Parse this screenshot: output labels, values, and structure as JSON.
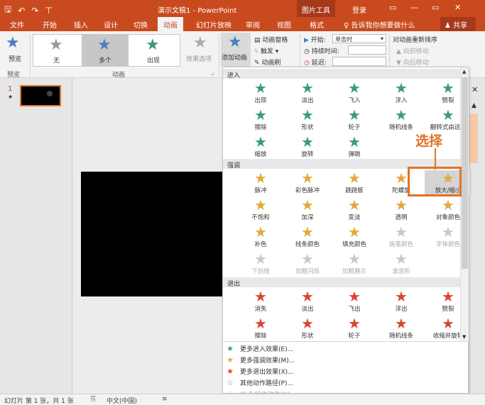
{
  "titlebar": {
    "title": "演示文稿1 - PowerPoint",
    "context": "图片工具",
    "login": "登录",
    "save_glyph": "🖫",
    "undo_glyph": "↶",
    "redo_glyph": "↷",
    "customize_glyph": "⊤",
    "min": "▭",
    "max": "▭",
    "close": "✕"
  },
  "tabs": [
    "文件",
    "开始",
    "插入",
    "设计",
    "切换",
    "动画",
    "幻灯片放映",
    "审阅",
    "视图",
    "格式"
  ],
  "tell": "告诉我你想要做什么",
  "share": "共享",
  "ribbon": {
    "preview": "预览",
    "group_preview": "预览",
    "gallery": [
      {
        "label": "无",
        "icon": "★"
      },
      {
        "label": "多个",
        "icon": "★"
      },
      {
        "label": "出现",
        "icon": "★"
      }
    ],
    "effect_options": "效果选项",
    "group_animation": "动画",
    "add_animation": "添加动画",
    "anim_pane": "动画窗格",
    "trigger": "触发",
    "anim_painter": "动画刷",
    "start_label": "开始:",
    "start_value": "单击时",
    "duration_label": "持续时间:",
    "delay_label": "延迟:",
    "reorder": "对动画重新排序",
    "move_earlier": "向前移动",
    "move_later": "向后移动"
  },
  "thumb": {
    "num": "1",
    "star": "★"
  },
  "dropdown": {
    "sec_entrance": "进入",
    "sec_emphasis": "强调",
    "sec_exit": "退出",
    "entrance": [
      [
        "出现",
        "淡出",
        "飞入",
        "浮入",
        "劈裂"
      ],
      [
        "擦除",
        "形状",
        "轮子",
        "随机线条",
        "翻转式由远..."
      ],
      [
        "缩放",
        "旋转",
        "弹跳"
      ]
    ],
    "emphasis": [
      [
        "脉冲",
        "彩色脉冲",
        "跷跷板",
        "陀螺旋",
        "放大/缩小"
      ],
      [
        "不饱和",
        "加深",
        "变淡",
        "透明",
        "对象颜色"
      ],
      [
        "补色",
        "线条颜色",
        "填充颜色",
        "画笔颜色",
        "字体颜色"
      ],
      [
        "下划线",
        "加粗闪烁",
        "加粗展示",
        "波浪形"
      ]
    ],
    "exit": [
      [
        "消失",
        "淡出",
        "飞出",
        "浮出",
        "劈裂"
      ],
      [
        "擦除",
        "形状",
        "轮子",
        "随机线条",
        "收缩并旋转"
      ]
    ],
    "more": [
      "更多进入效果(E)...",
      "更多强调效果(M)...",
      "更多退出效果(X)...",
      "其他动作路径(P)...",
      "OLE 操作动作(O)..."
    ]
  },
  "callout": "选择",
  "status": {
    "slide": "幻灯片 第 1 张，共 1 张",
    "lang": "中文(中国)"
  },
  "colors": {
    "accent": "#c94a1e",
    "entrance": "#3a9a7c",
    "emphasis": "#e3a93c",
    "exit": "#d9462c",
    "callout": "#e07328"
  }
}
